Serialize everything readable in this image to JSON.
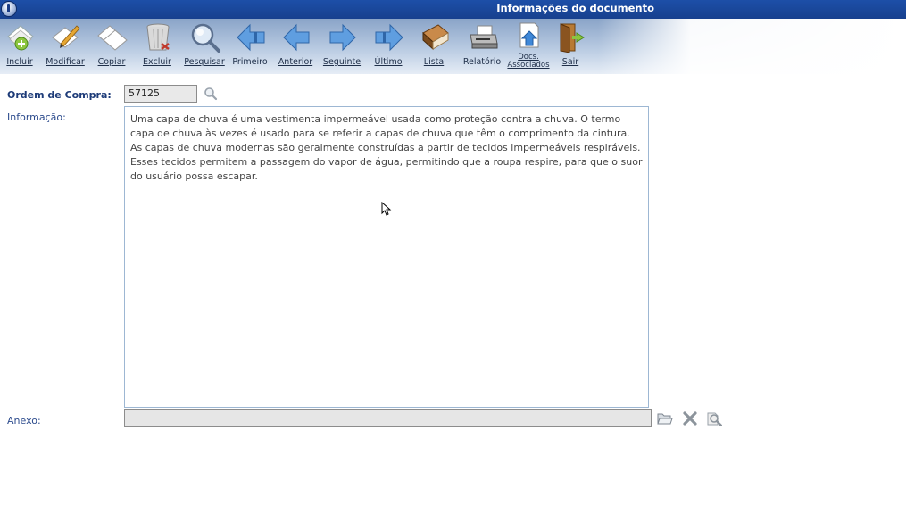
{
  "window": {
    "title": "Informações do documento"
  },
  "toolbar": {
    "buttons": [
      {
        "label": "Incluir",
        "icon": "add-document-icon"
      },
      {
        "label": "Modificar",
        "icon": "edit-document-icon"
      },
      {
        "label": "Copiar",
        "icon": "copy-document-icon"
      },
      {
        "label": "Excluir",
        "icon": "trash-icon"
      },
      {
        "label": "Pesquisar",
        "icon": "magnifier-icon"
      },
      {
        "label": "Primeiro",
        "icon": "first-arrow-icon"
      },
      {
        "label": "Anterior",
        "icon": "previous-arrow-icon"
      },
      {
        "label": "Seguinte",
        "icon": "next-arrow-icon"
      },
      {
        "label": "Último",
        "icon": "last-arrow-icon"
      },
      {
        "label": "Lista",
        "icon": "book-list-icon"
      },
      {
        "label": "Relatório",
        "icon": "printer-icon"
      },
      {
        "label": "Docs.\nAssociados",
        "icon": "associated-docs-icon"
      },
      {
        "label": "Sair",
        "icon": "exit-door-icon"
      }
    ]
  },
  "form": {
    "order_label": "Ordem de Compra:",
    "order_value": "57125",
    "info_label": "Informação:",
    "info_text": "Uma capa de chuva é uma vestimenta impermeável usada como proteção contra a chuva. O termo capa de chuva às vezes é usado para se referir a capas de chuva que têm o comprimento da cintura. As capas de chuva modernas são geralmente construídas a partir de tecidos impermeáveis respiráveis. Esses tecidos permitem a passagem do vapor de água, permitindo que a roupa respire, para que o suor do usuário possa escapar.",
    "attachment_label": "Anexo:",
    "attachment_value": ""
  },
  "colors": {
    "title_bar": "#1d4fa8",
    "label_text": "#2b4a8c",
    "arrow_blue": "#4f8fd8"
  }
}
